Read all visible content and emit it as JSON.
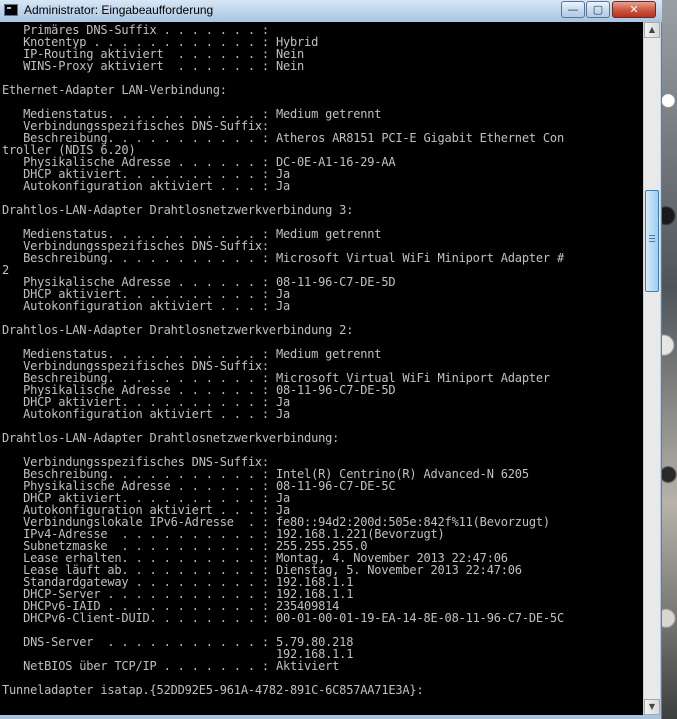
{
  "window": {
    "title": "Administrator: Eingabeaufforderung",
    "icon": "cmd-icon",
    "controls": {
      "minimize": "minimize-icon",
      "maximize": "maximize-icon",
      "close": "close-icon"
    }
  },
  "console": {
    "lines": [
      "   Primäres DNS-Suffix . . . . . . . :",
      "   Knotentyp . . . . . . . . . . . . : Hybrid",
      "   IP-Routing aktiviert  . . . . . . : Nein",
      "   WINS-Proxy aktiviert  . . . . . . : Nein",
      "",
      "Ethernet-Adapter LAN-Verbindung:",
      "",
      "   Medienstatus. . . . . . . . . . . : Medium getrennt",
      "   Verbindungsspezifisches DNS-Suffix:",
      "   Beschreibung. . . . . . . . . . . : Atheros AR8151 PCI-E Gigabit Ethernet Con",
      "troller (NDIS 6.20)",
      "   Physikalische Adresse . . . . . . : DC-0E-A1-16-29-AA",
      "   DHCP aktiviert. . . . . . . . . . : Ja",
      "   Autokonfiguration aktiviert . . . : Ja",
      "",
      "Drahtlos-LAN-Adapter Drahtlosnetzwerkverbindung 3:",
      "",
      "   Medienstatus. . . . . . . . . . . : Medium getrennt",
      "   Verbindungsspezifisches DNS-Suffix:",
      "   Beschreibung. . . . . . . . . . . : Microsoft Virtual WiFi Miniport Adapter #",
      "2",
      "   Physikalische Adresse . . . . . . : 08-11-96-C7-DE-5D",
      "   DHCP aktiviert. . . . . . . . . . : Ja",
      "   Autokonfiguration aktiviert . . . : Ja",
      "",
      "Drahtlos-LAN-Adapter Drahtlosnetzwerkverbindung 2:",
      "",
      "   Medienstatus. . . . . . . . . . . : Medium getrennt",
      "   Verbindungsspezifisches DNS-Suffix:",
      "   Beschreibung. . . . . . . . . . . : Microsoft Virtual WiFi Miniport Adapter",
      "   Physikalische Adresse . . . . . . : 08-11-96-C7-DE-5D",
      "   DHCP aktiviert. . . . . . . . . . : Ja",
      "   Autokonfiguration aktiviert . . . : Ja",
      "",
      "Drahtlos-LAN-Adapter Drahtlosnetzwerkverbindung:",
      "",
      "   Verbindungsspezifisches DNS-Suffix:",
      "   Beschreibung. . . . . . . . . . . : Intel(R) Centrino(R) Advanced-N 6205",
      "   Physikalische Adresse . . . . . . : 08-11-96-C7-DE-5C",
      "   DHCP aktiviert. . . . . . . . . . : Ja",
      "   Autokonfiguration aktiviert . . . : Ja",
      "   Verbindungslokale IPv6-Adresse  . : fe80::94d2:200d:505e:842f%11(Bevorzugt)",
      "   IPv4-Adresse  . . . . . . . . . . : 192.168.1.221(Bevorzugt)",
      "   Subnetzmaske  . . . . . . . . . . : 255.255.255.0",
      "   Lease erhalten. . . . . . . . . . : Montag, 4. November 2013 22:47:06",
      "   Lease läuft ab. . . . . . . . . . : Dienstag, 5. November 2013 22:47:06",
      "   Standardgateway . . . . . . . . . : 192.168.1.1",
      "   DHCP-Server . . . . . . . . . . . : 192.168.1.1",
      "   DHCPv6-IAID . . . . . . . . . . . : 235409814",
      "   DHCPv6-Client-DUID. . . . . . . . : 00-01-00-01-19-EA-14-8E-08-11-96-C7-DE-5C",
      "",
      "   DNS-Server  . . . . . . . . . . . : 5.79.80.218",
      "                                       192.168.1.1",
      "   NetBIOS über TCP/IP . . . . . . . : Aktiviert",
      "",
      "Tunneladapter isatap.{52DD92E5-961A-4782-891C-6C857AA71E3A}:"
    ]
  },
  "scrollbar": {
    "up_icon": "arrow-up-icon",
    "down_icon": "arrow-down-icon"
  },
  "colors": {
    "console_bg": "#000000",
    "console_fg": "#c0c0c0",
    "title_bar": "#bcd3ea",
    "close_button": "#c8402a"
  }
}
